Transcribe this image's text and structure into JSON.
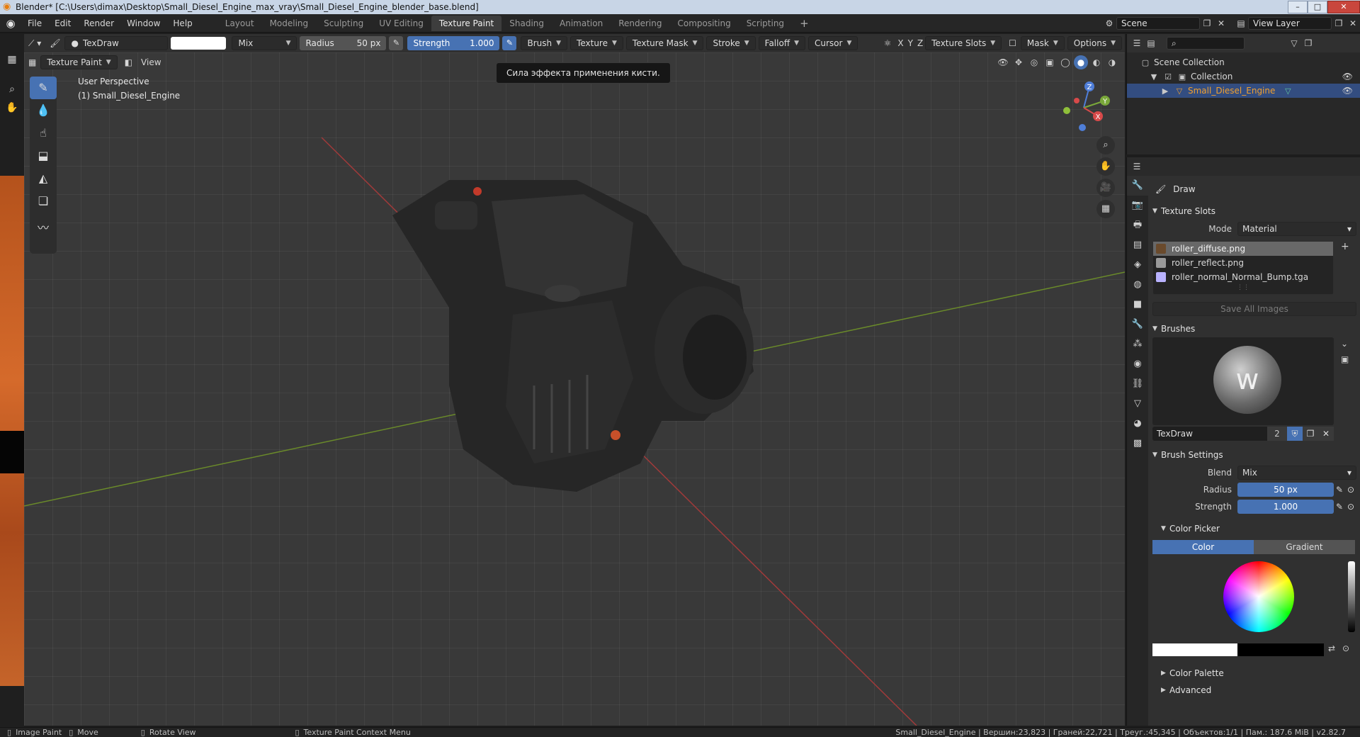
{
  "window": {
    "title": "Blender* [C:\\Users\\dimax\\Desktop\\Small_Diesel_Engine_max_vray\\Small_Diesel_Engine_blender_base.blend]",
    "controls": [
      "–",
      "□",
      "✕"
    ]
  },
  "menu": [
    "File",
    "Edit",
    "Render",
    "Window",
    "Help"
  ],
  "workspaces": [
    "Layout",
    "Modeling",
    "Sculpting",
    "UV Editing",
    "Texture Paint",
    "Shading",
    "Animation",
    "Rendering",
    "Compositing",
    "Scripting",
    "+"
  ],
  "active_workspace": "Texture Paint",
  "scene": {
    "name": "Scene",
    "view_layer": "View Layer"
  },
  "toolheader": {
    "brush_name": "TexDraw",
    "blend": "Mix",
    "radius_label": "Radius",
    "radius_value": "50 px",
    "strength_label": "Strength",
    "strength_value": "1.000",
    "menus": [
      "Brush",
      "Texture",
      "Texture Mask",
      "Stroke",
      "Falloff",
      "Cursor"
    ],
    "axes": [
      "X",
      "Y",
      "Z"
    ],
    "right_menus": [
      "Texture Slots",
      "Mask",
      "Options"
    ]
  },
  "viewport_header": {
    "mode": "Texture Paint",
    "view": "View"
  },
  "viewport": {
    "perspective": "User Perspective",
    "object": "(1) Small_Diesel_Engine",
    "tooltip": "Сила эффекта применения кисти."
  },
  "outliner": {
    "scene_collection": "Scene Collection",
    "collection": "Collection",
    "object": "Small_Diesel_Engine"
  },
  "properties": {
    "tool_name": "Draw",
    "texture_slots_title": "Texture Slots",
    "mode_label": "Mode",
    "mode_value": "Material",
    "slots": [
      {
        "name": "roller_diffuse.png",
        "color": "#6a4a2c"
      },
      {
        "name": "roller_reflect.png",
        "color": "#9a9a9a"
      },
      {
        "name": "roller_normal_Normal_Bump.tga",
        "color": "#b9b2ff"
      }
    ],
    "save_all": "Save All Images",
    "brushes_title": "Brushes",
    "brush_name": "TexDraw",
    "brush_users": "2",
    "brush_settings_title": "Brush Settings",
    "blend_label": "Blend",
    "blend_value": "Mix",
    "radius_label": "Radius",
    "radius_value": "50 px",
    "strength_label": "Strength",
    "strength_value": "1.000",
    "color_picker_title": "Color Picker",
    "color_tab": "Color",
    "gradient_tab": "Gradient",
    "color_palette": "Color Palette",
    "advanced": "Advanced"
  },
  "statusbar": {
    "items": [
      "Image Paint",
      "Move",
      "Rotate View",
      "Texture Paint Context Menu"
    ],
    "stats": "Small_Diesel_Engine | Вершин:23,823 | Граней:22,721 | Треуг.:45,345 | Объектов:1/1 | Пам.: 187.6 MiB | v2.82.7"
  },
  "colors": {
    "accent": "#4772b3",
    "selection": "#334d80",
    "object_name": "#f0a030"
  }
}
